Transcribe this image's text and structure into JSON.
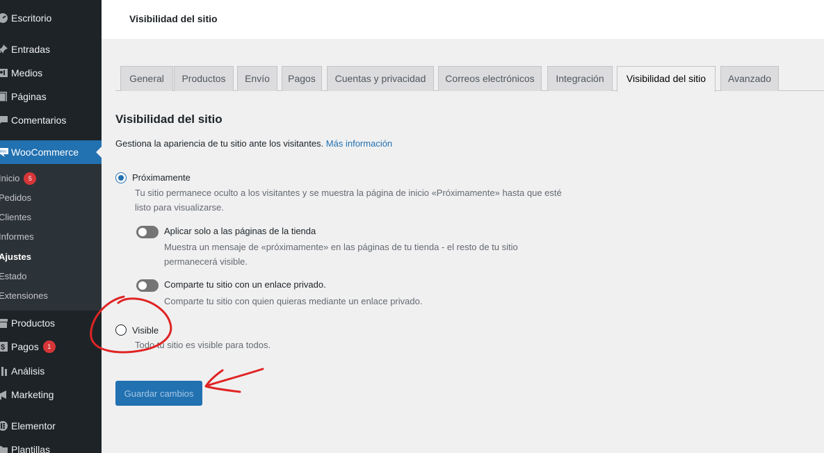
{
  "sidebar": {
    "items": [
      {
        "label": "Escritorio"
      },
      {
        "label": "Entradas"
      },
      {
        "label": "Medios"
      },
      {
        "label": "Páginas"
      },
      {
        "label": "Comentarios"
      },
      {
        "label": "WooCommerce"
      },
      {
        "label": "Productos"
      },
      {
        "label": "Pagos",
        "badge": "1"
      },
      {
        "label": "Análisis"
      },
      {
        "label": "Marketing"
      },
      {
        "label": "Elementor"
      },
      {
        "label": "Plantillas"
      }
    ],
    "submenu": [
      {
        "label": "Inicio",
        "badge": "5"
      },
      {
        "label": "Pedidos"
      },
      {
        "label": "Clientes"
      },
      {
        "label": "Informes"
      },
      {
        "label": "Ajustes"
      },
      {
        "label": "Estado"
      },
      {
        "label": "Extensiones"
      }
    ]
  },
  "header": {
    "title": "Visibilidad del sitio"
  },
  "tabs": [
    {
      "label": "General"
    },
    {
      "label": "Productos"
    },
    {
      "label": "Envío"
    },
    {
      "label": "Pagos"
    },
    {
      "label": "Cuentas y privacidad"
    },
    {
      "label": "Correos electrónicos"
    },
    {
      "label": "Integración"
    },
    {
      "label": "Visibilidad del sitio"
    },
    {
      "label": "Avanzado"
    }
  ],
  "main": {
    "title": "Visibilidad del sitio",
    "description": "Gestiona la apariencia de tu sitio ante los visitantes.",
    "more_info_link": "Más información",
    "coming_soon": {
      "label": "Próximamente",
      "desc_line1": "Tu sitio permanece oculto a los visitantes y se muestra la página de inicio «Próximamente» hasta que esté",
      "desc_line2": "listo para visualizarse."
    },
    "store_only": {
      "label": "Aplicar solo a las páginas de la tienda",
      "desc_line1": "Muestra un mensaje de «próximamente» en las páginas de tu tienda - el resto de tu sitio",
      "desc_line2": "permanecerá visible."
    },
    "private_link": {
      "label": "Comparte tu sitio con un enlace privado.",
      "desc": "Comparte tu sitio con quien quieras mediante un enlace privado."
    },
    "visible": {
      "label": "Visible",
      "desc": "Todo tu sitio es visible para todos."
    },
    "save_label": "Guardar cambios"
  },
  "colors": {
    "sidebar_bg": "#1d2327",
    "accent": "#2271b1",
    "badge": "#d63638",
    "annotation": "#e02424"
  }
}
